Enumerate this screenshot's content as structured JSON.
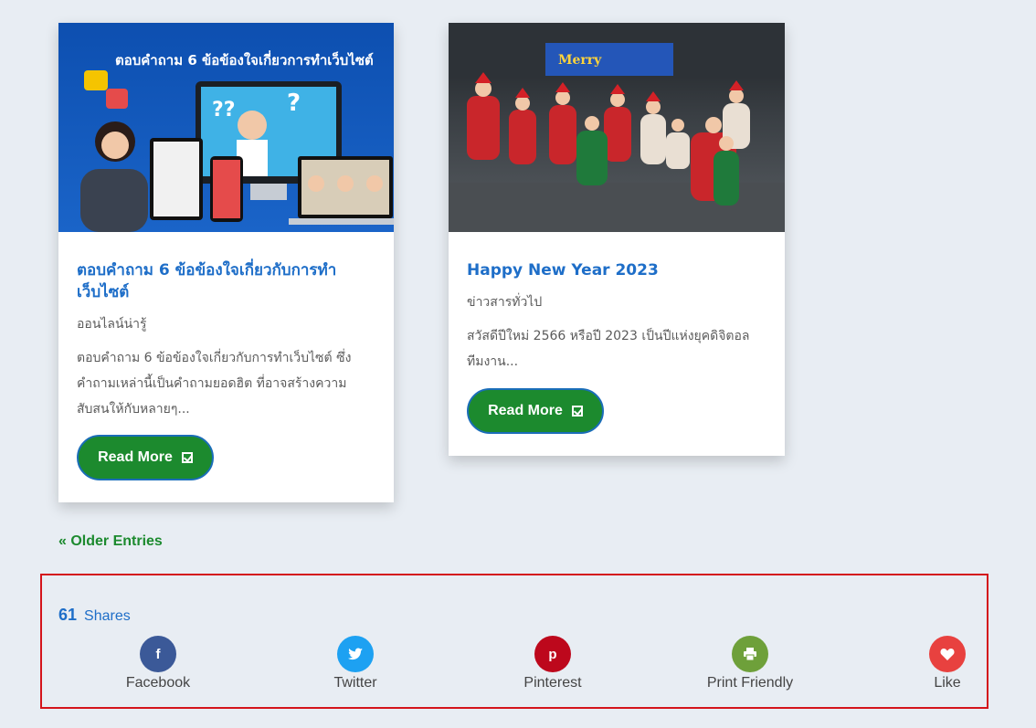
{
  "posts": [
    {
      "image_heading": "ตอบคำถาม 6 ข้อข้องใจเกี่ยวการทำเว็บไซต์",
      "title": "ตอบคำถาม 6 ข้อข้องใจเกี่ยวกับการทำเว็บไซต์",
      "category": "ออนไลน์น่ารู้",
      "excerpt": "ตอบคำถาม 6 ข้อข้องใจเกี่ยวกับการทำเว็บไซต์ ซึ่งคำถามเหล่านี้เป็นคำถามยอดฮิต ที่อาจสร้างความสับสนให้กับหลายๆ...",
      "read_more": "Read More"
    },
    {
      "image_banner": "Merry",
      "title": "Happy New Year 2023",
      "category": "ข่าวสารทั่วไป",
      "excerpt": "สวัสดีปีใหม่ 2566 หรือปี 2023 เป็นปีแห่งยุคดิจิตอล ทีมงาน...",
      "read_more": "Read More"
    }
  ],
  "pagination": {
    "older": "« Older Entries"
  },
  "share": {
    "count": "61",
    "count_label": "Shares",
    "buttons": [
      {
        "label": "Facebook",
        "glyph": "f",
        "color": "#3b5998",
        "icon": "facebook-icon"
      },
      {
        "label": "Twitter",
        "glyph": "t",
        "color": "#1da1f2",
        "icon": "twitter-icon"
      },
      {
        "label": "Pinterest",
        "glyph": "p",
        "color": "#bd081c",
        "icon": "pinterest-icon"
      },
      {
        "label": "Print Friendly",
        "glyph": "",
        "color": "#6ea03a",
        "icon": "print-icon"
      },
      {
        "label": "Like",
        "glyph": "",
        "color": "#e8413f",
        "icon": "heart-icon"
      }
    ]
  },
  "colors": {
    "accent": "#1c8a2e",
    "title": "#1e6ec8",
    "highlight_border": "#d4141b"
  }
}
